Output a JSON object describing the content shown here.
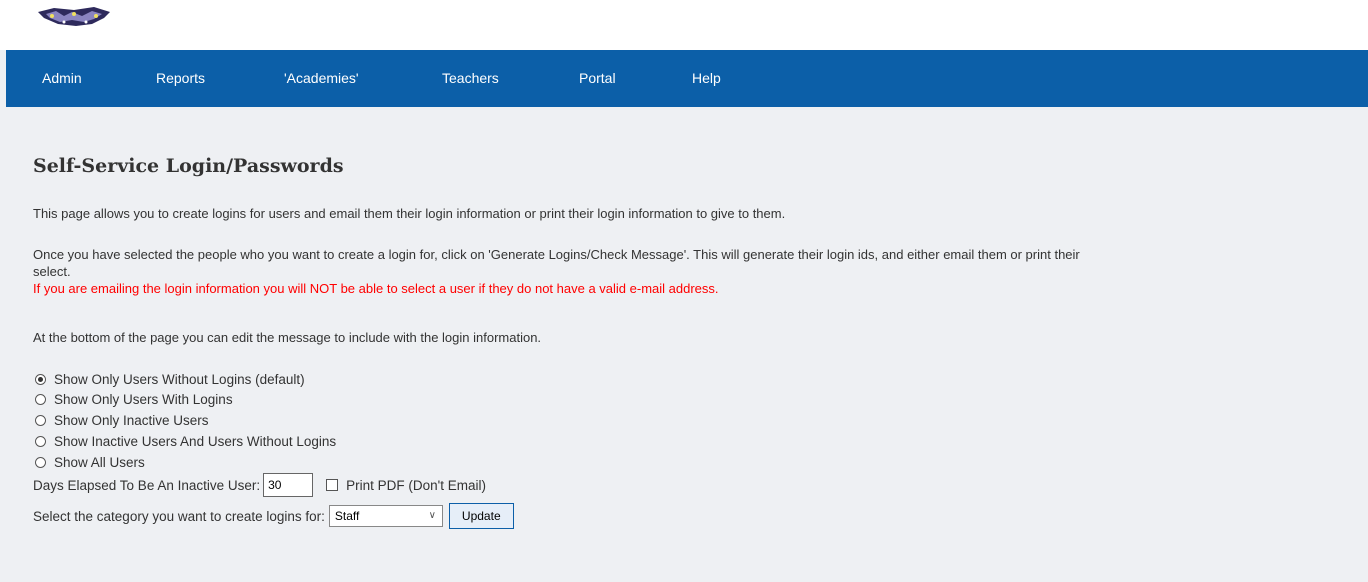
{
  "nav": {
    "items": [
      {
        "label": "Admin"
      },
      {
        "label": "Reports"
      },
      {
        "label": "'Academies'"
      },
      {
        "label": "Teachers"
      },
      {
        "label": "Portal"
      },
      {
        "label": "Help"
      }
    ]
  },
  "page": {
    "title": "Self-Service Login/Passwords",
    "intro": "This page allows you to create logins for users and email them their login information or print their login information to give to them.",
    "instructions_line1": "Once you have selected the people who you want to create a login for, click on 'Generate Logins/Check Message'. This will generate their login ids, and either email them or print their",
    "instructions_line2": "select.",
    "warning": "If you are emailing the login information you will NOT be able to select a user if they do not have a valid e-mail address.",
    "bottom_note": "At the bottom of the page you can edit the message to include with the login information."
  },
  "filters": {
    "options": [
      {
        "label": "Show Only Users Without Logins (default)",
        "checked": true
      },
      {
        "label": "Show Only Users With Logins",
        "checked": false
      },
      {
        "label": "Show Only Inactive Users",
        "checked": false
      },
      {
        "label": "Show Inactive Users And Users Without Logins",
        "checked": false
      },
      {
        "label": "Show All Users",
        "checked": false
      }
    ],
    "days_label": "Days Elapsed To Be An Inactive User:",
    "days_value": "30",
    "print_pdf_label": "Print PDF (Don't Email)",
    "print_pdf_checked": false,
    "category_label": "Select the category you want to create logins for:",
    "category_value": "Staff",
    "update_label": "Update"
  },
  "colors": {
    "nav_bg": "#0c5fa8",
    "page_bg": "#eef0f3",
    "warning": "#ff0000"
  }
}
